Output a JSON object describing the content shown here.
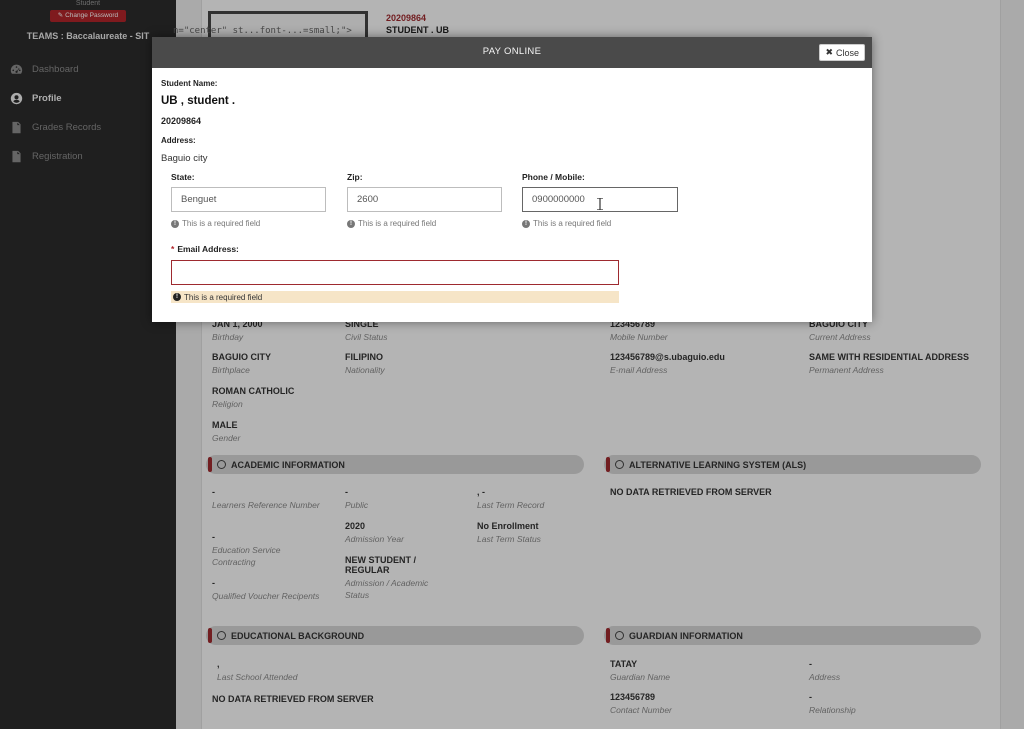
{
  "sidebar": {
    "role": "Student",
    "change_password": "Change Password",
    "teams": "TEAMS : Baccalaureate - SIT",
    "items": [
      {
        "label": "Dashboard",
        "icon": "dashboard-icon"
      },
      {
        "label": "Profile",
        "icon": "user-circle-icon"
      },
      {
        "label": "Grades Records",
        "icon": "document-icon"
      },
      {
        "label": "Registration",
        "icon": "file-icon"
      }
    ]
  },
  "header": {
    "id": "20209864",
    "name": "STUDENT . UB",
    "code_leak": "n=\"center\" st...font-...=small;\">"
  },
  "personal": [
    {
      "value": "JAN 1, 2000",
      "label": "Birthday"
    },
    {
      "value": "SINGLE",
      "label": "Civil Status"
    },
    {
      "value": "123456789",
      "label": "Mobile Number"
    },
    {
      "value": "BAGUIO CITY",
      "label": "Current Address"
    },
    {
      "value": "BAGUIO CITY",
      "label": "Birthplace"
    },
    {
      "value": "FILIPINO",
      "label": "Nationality"
    },
    {
      "value": "123456789@s.ubaguio.edu",
      "label": "E-mail Address"
    },
    {
      "value": "SAME WITH RESIDENTIAL ADDRESS",
      "label": "Permanent Address"
    },
    {
      "value": "ROMAN CATHOLIC",
      "label": "Religion"
    },
    {
      "value": "MALE",
      "label": "Gender"
    }
  ],
  "sections": {
    "academic": "ACADEMIC INFORMATION",
    "als": "ALTERNATIVE LEARNING SYSTEM (ALS)",
    "education": "EDUCATIONAL BACKGROUND",
    "guardian": "GUARDIAN INFORMATION"
  },
  "academic": [
    {
      "value": "-",
      "label": "Learners Reference Number"
    },
    {
      "value": "-",
      "label": "Public"
    },
    {
      "value": ", -",
      "label": "Last Term Record"
    },
    {
      "value": "-",
      "label": "Education Service Contracting"
    },
    {
      "value": "2020",
      "label": "Admission Year"
    },
    {
      "value": "No Enrollment",
      "label": "Last Term Status"
    },
    {
      "value": "-",
      "label": "Qualified Voucher Recipents"
    },
    {
      "value": "NEW STUDENT / REGULAR",
      "label": "Admission / Academic Status"
    }
  ],
  "als_text": "NO DATA RETRIEVED FROM SERVER",
  "education": {
    "school_value": ",",
    "school_label": "Last School Attended",
    "nodata": "NO DATA RETRIEVED FROM SERVER"
  },
  "guardian": [
    {
      "value": "TATAY",
      "label": "Guardian Name"
    },
    {
      "value": "-",
      "label": "Address"
    },
    {
      "value": "123456789",
      "label": "Contact Number"
    },
    {
      "value": "-",
      "label": "Relationship"
    }
  ],
  "modal": {
    "title": "PAY ONLINE",
    "close_label": "Close",
    "student_name_label": "Student Name:",
    "student_name": "UB , student .",
    "student_id": "20209864",
    "address_label": "Address:",
    "address": "Baguio city",
    "state_label": "State:",
    "state_value": "Benguet",
    "zip_label": "Zip:",
    "zip_value": "2600",
    "phone_label": "Phone / Mobile:",
    "phone_value": "0900000000",
    "email_label": "Email Address:",
    "email_value": "",
    "required_hint": "This is a required field"
  },
  "colors": {
    "accent": "#9e2a2f",
    "sidebar": "#2b2b2b",
    "modal_header": "#4a4a4a",
    "error_bg": "#f6e5c7"
  }
}
